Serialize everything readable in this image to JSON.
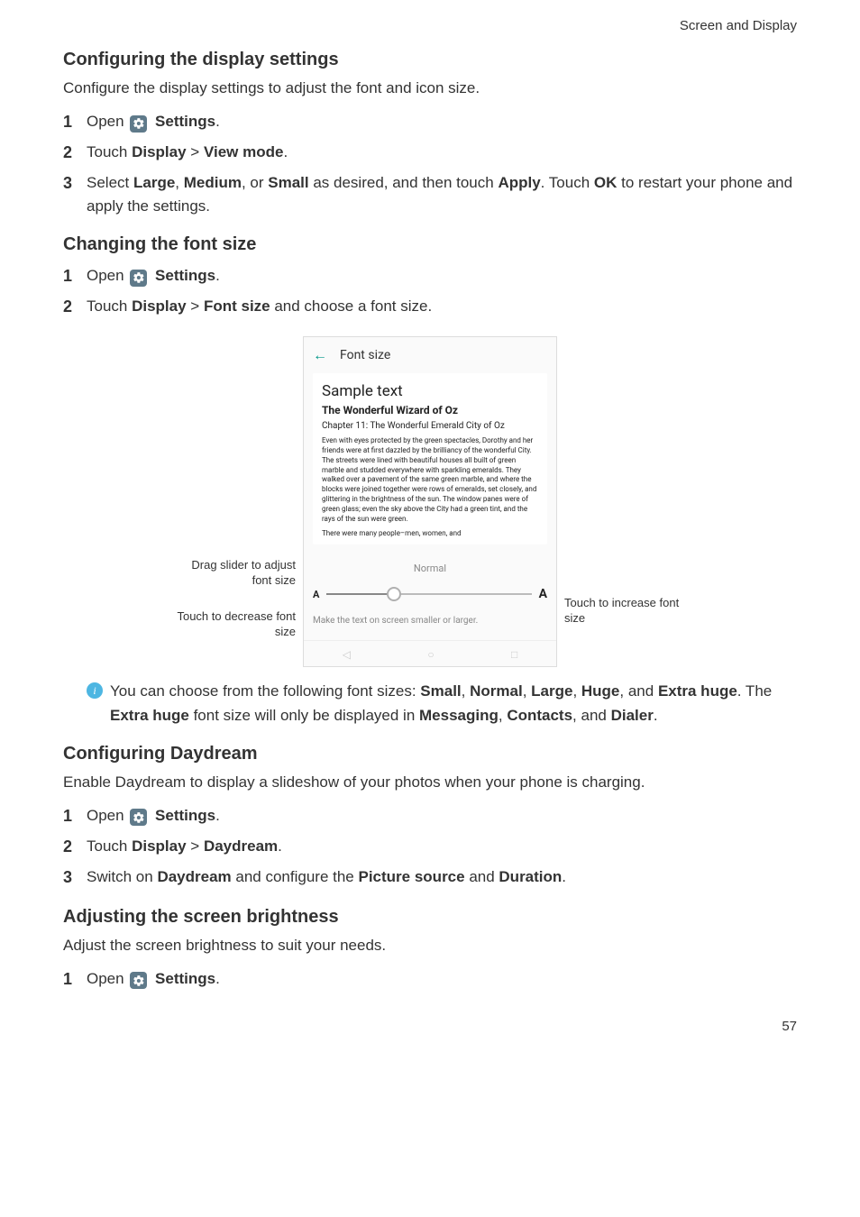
{
  "breadcrumb": "Screen and Display",
  "sec1": {
    "title": "Configuring the display settings",
    "lead": "Configure the display settings to adjust the font and icon size.",
    "s1_open": "Open ",
    "s1_settings": "Settings",
    "s1_dot": ".",
    "s2_a": "Touch ",
    "s2_b": "Display",
    "s2_c": " > ",
    "s2_d": "View mode",
    "s2_e": ".",
    "s3_a": "Select ",
    "s3_b": "Large",
    "s3_c": ", ",
    "s3_d": "Medium",
    "s3_e": ", or ",
    "s3_f": "Small",
    "s3_g": " as desired, and then touch ",
    "s3_h": "Apply",
    "s3_i": ". Touch ",
    "s3_j": "OK",
    "s3_k": " to restart your phone and apply the settings."
  },
  "sec2": {
    "title": "Changing the font size",
    "s1_open": "Open ",
    "s1_settings": "Settings",
    "s1_dot": ".",
    "s2_a": "Touch ",
    "s2_b": "Display",
    "s2_c": " > ",
    "s2_d": "Font size",
    "s2_e": " and choose a font size."
  },
  "figure": {
    "left_drag": "Drag slider to adjust font size",
    "left_dec": "Touch to decrease font size",
    "right_inc": "Touch to increase font size",
    "topbar": "Font size",
    "sample": "Sample text",
    "wiz": "The Wonderful Wizard of Oz",
    "chapter": "Chapter 11: The Wonderful Emerald City of Oz",
    "para1": "Even with eyes protected by the green spectacles, Dorothy and her friends were at first dazzled by the brilliancy of the wonderful City. The streets were lined with beautiful houses all built of green marble and studded everywhere with sparkling emeralds. They walked over a pavement of the same green marble, and where the blocks were joined together were rows of emeralds, set closely, and glittering in the brightness of the sun. The window panes were of green glass; even the sky above the City had a green tint, and the rays of the sun were green.",
    "para2": "There were many people–men, women, and",
    "slider_label": "Normal",
    "endA_small": "A",
    "endA_large": "A",
    "help": "Make the text on screen smaller or larger."
  },
  "note": {
    "a": "You can choose from the following font sizes: ",
    "b": "Small",
    "c": ", ",
    "d": "Normal",
    "e": ", ",
    "f": "Large",
    "g": ", ",
    "h": "Huge",
    "i": ", and ",
    "j": "Extra huge",
    "k": ". The ",
    "l": "Extra huge",
    "m": " font size will only be displayed in ",
    "n": "Messaging",
    "o": ", ",
    "p": "Contacts",
    "q": ", and ",
    "r": "Dialer",
    "s": "."
  },
  "sec3": {
    "title": "Configuring Daydream",
    "lead": "Enable Daydream to display a slideshow of your photos when your phone is charging.",
    "s1_open": "Open ",
    "s1_settings": "Settings",
    "s1_dot": ".",
    "s2_a": "Touch ",
    "s2_b": "Display",
    "s2_c": " > ",
    "s2_d": "Daydream",
    "s2_e": ".",
    "s3_a": "Switch on ",
    "s3_b": "Daydream",
    "s3_c": " and configure the ",
    "s3_d": "Picture source",
    "s3_e": " and ",
    "s3_f": "Duration",
    "s3_g": "."
  },
  "sec4": {
    "title": "Adjusting the screen brightness",
    "lead": "Adjust the screen brightness to suit your needs.",
    "s1_open": "Open ",
    "s1_settings": "Settings",
    "s1_dot": "."
  },
  "pagenum": "57"
}
